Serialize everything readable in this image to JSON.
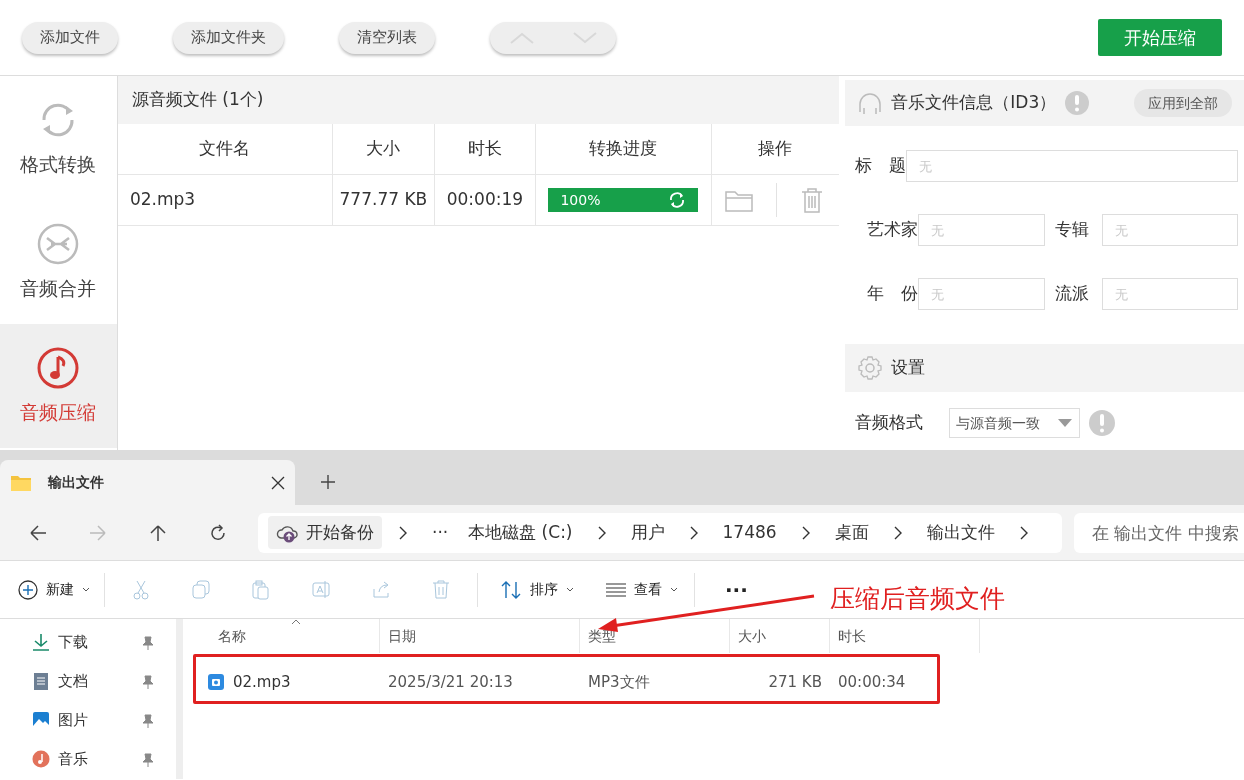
{
  "toolbar": {
    "buttons": [
      "添加文件",
      "添加文件夹",
      "清空列表"
    ],
    "start_button": "开始压缩"
  },
  "sidebar": {
    "items": [
      {
        "label": "格式转换",
        "selected": false
      },
      {
        "label": "音频合并",
        "selected": false
      },
      {
        "label": "音频压缩",
        "selected": true
      }
    ]
  },
  "file_panel": {
    "title": "源音频文件 (1个)",
    "columns": [
      "文件名",
      "大小",
      "时长",
      "转换进度",
      "操作"
    ],
    "rows": [
      {
        "name": "02.mp3",
        "size": "777.77 KB",
        "duration": "00:00:19",
        "progress": "100%",
        "level": 1.0
      }
    ]
  },
  "id3": {
    "title": "音乐文件信息（ID3）",
    "apply_button": "应用到全部",
    "fields": [
      {
        "label": "标　题",
        "placeholder": "无",
        "wide": true
      },
      {
        "label": "艺术家",
        "placeholder": "无",
        "wide": false
      },
      {
        "label": "专辑",
        "placeholder": "无",
        "wide": false
      },
      {
        "label": "年　份",
        "placeholder": "无",
        "wide": false
      },
      {
        "label": "流派",
        "placeholder": "无",
        "wide": false
      }
    ]
  },
  "settings": {
    "title": "设置",
    "format_label": "音频格式",
    "format_value": "与源音频一致"
  },
  "explorer": {
    "tab_title": "输出文件",
    "breadcrumbs": [
      "开始备份",
      "···",
      "本地磁盘 (C:)",
      "用户",
      "17486",
      "桌面",
      "输出文件"
    ],
    "search_placeholder": "在 输出文件 中搜索",
    "new_button": "新建",
    "icon_tools": [
      {
        "disabled": true
      },
      {
        "disabled": true
      },
      {
        "disabled": true
      },
      {
        "disabled": true
      },
      {
        "disabled": true
      },
      {
        "disabled": true
      }
    ],
    "sort_button": "排序",
    "view_button": "查看",
    "more_button": "···",
    "nav_items": [
      {
        "label": "下载",
        "pinned": true
      },
      {
        "label": "文档",
        "pinned": true
      },
      {
        "label": "图片",
        "pinned": true
      },
      {
        "label": "音乐",
        "pinned": true
      }
    ],
    "columns": [
      "名称",
      "日期",
      "类型",
      "大小",
      "时长"
    ],
    "files": [
      {
        "name": "02.mp3",
        "date": "2025/3/21 20:13",
        "type": "MP3文件",
        "size": "271 KB",
        "duration": "00:00:34",
        "selected": false
      }
    ]
  },
  "annotation": {
    "text": "压缩后音频文件"
  }
}
